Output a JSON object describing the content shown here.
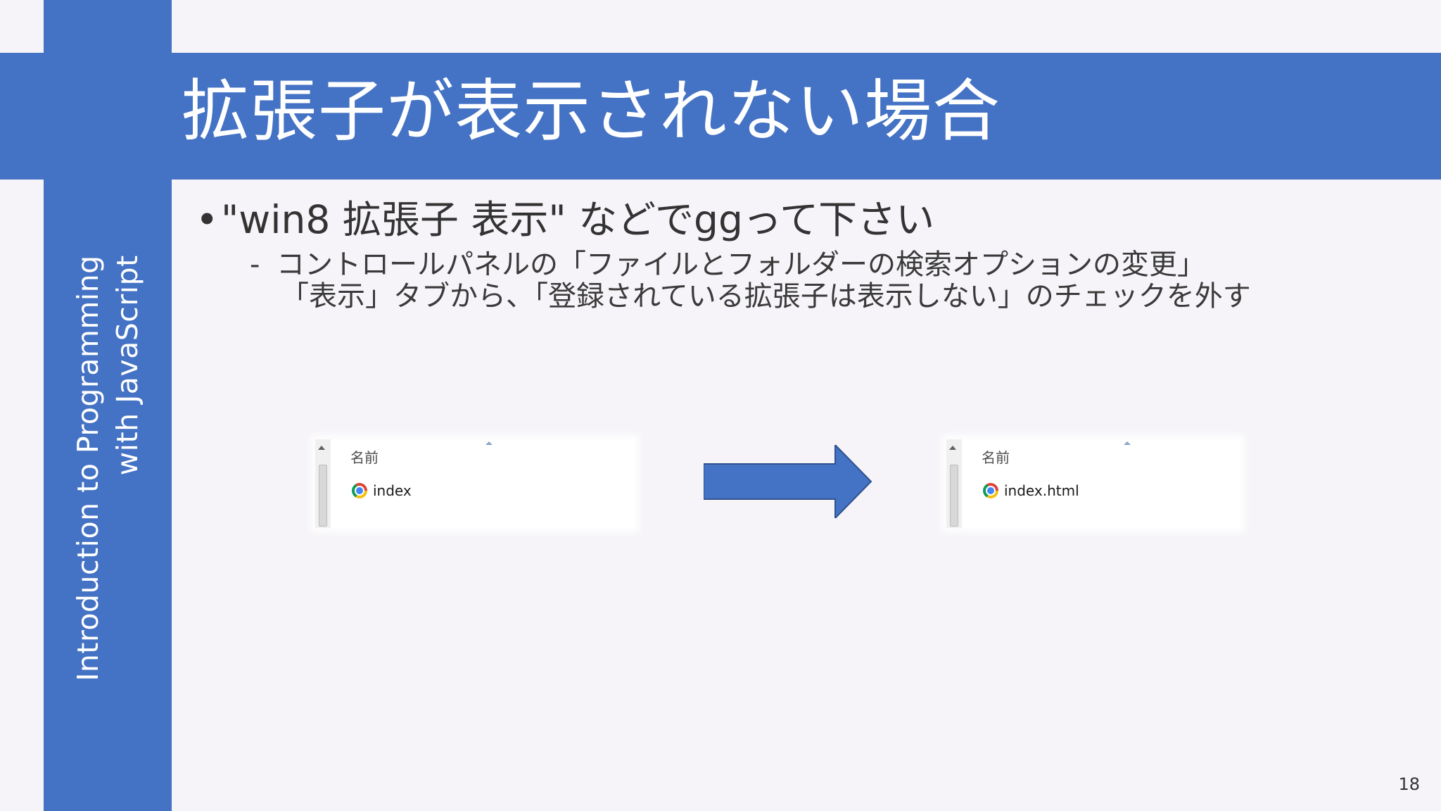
{
  "slide": {
    "title": "拡張子が表示されない場合",
    "sidebar_line1": "Introduction to Programming",
    "sidebar_line2": "with JavaScript",
    "page_number": "18"
  },
  "content": {
    "bullet_marker": "•",
    "bullet": "\"win8 拡張子 表示\" などでggって下さい",
    "sub_marker": "-",
    "sub_line1": "コントロールパネルの「ファイルとフォルダーの検索オプションの変更」",
    "sub_line2": "「表示」タブから、「登録されている拡張子は表示しない」のチェックを外す"
  },
  "explorer_before": {
    "column_header": "名前",
    "file_name": "index"
  },
  "explorer_after": {
    "column_header": "名前",
    "file_name": "index.html"
  },
  "colors": {
    "accent": "#4472c4",
    "background": "#f6f4f8"
  }
}
